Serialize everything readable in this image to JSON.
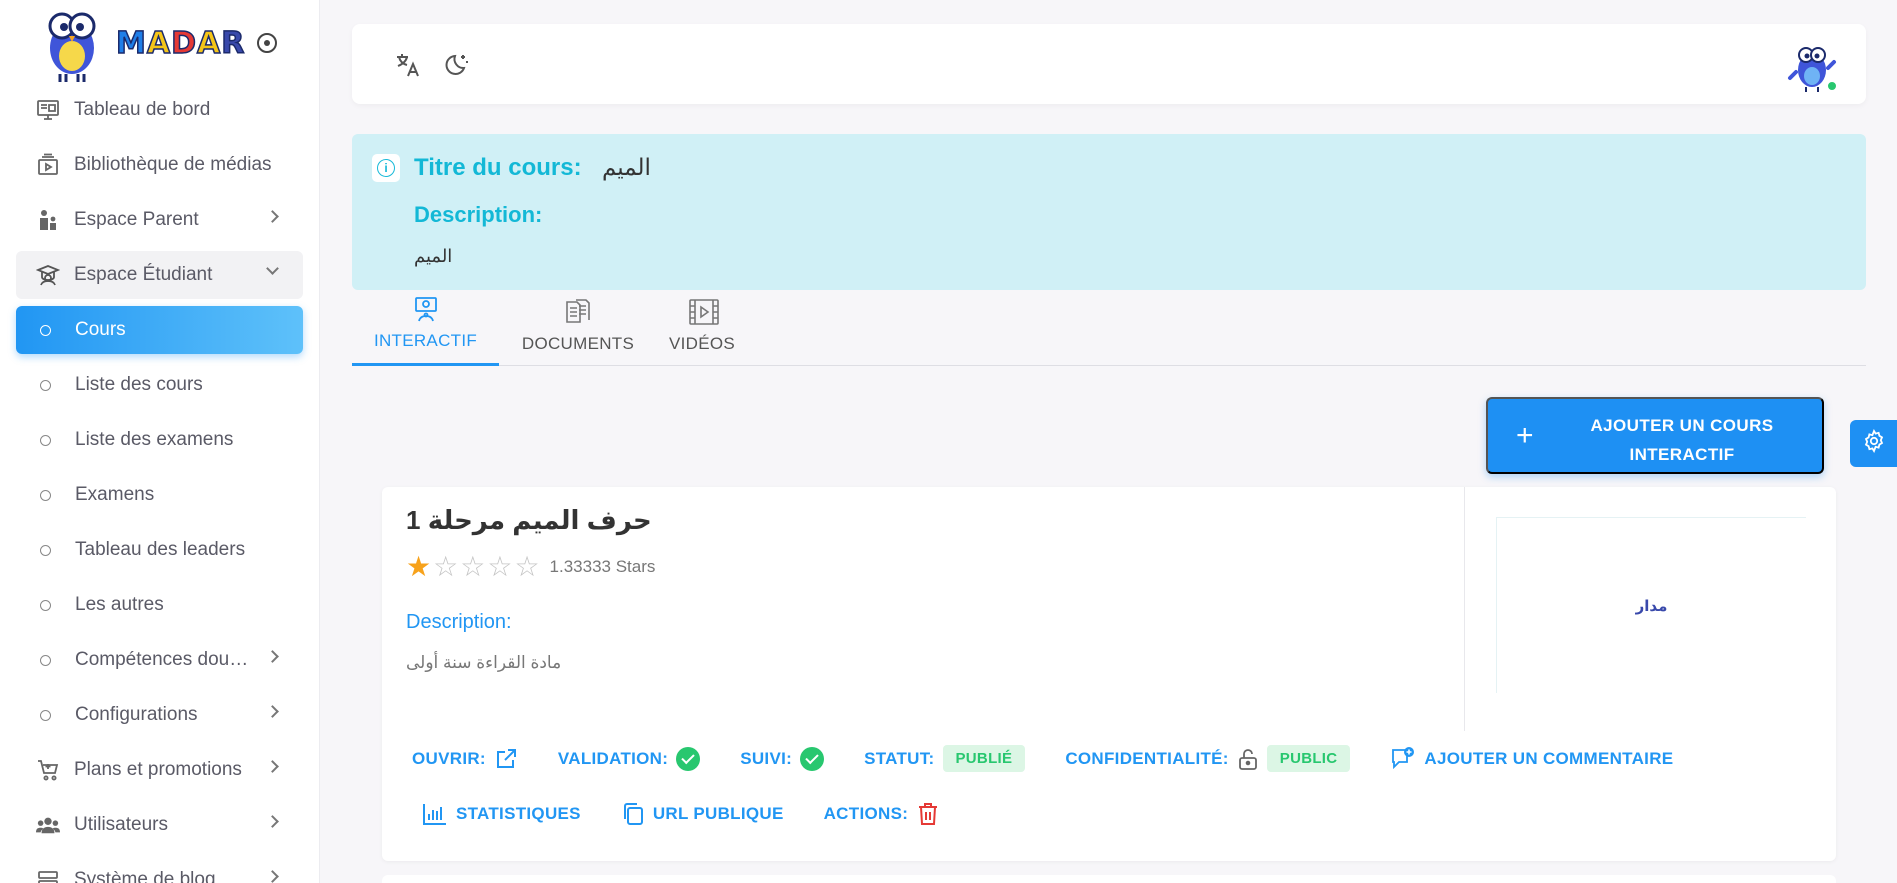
{
  "brand": {
    "name_letters": [
      "M",
      "A",
      "D",
      "A",
      "R"
    ],
    "letter_colors": [
      "#1f7ee8",
      "#f5c518",
      "#e53935",
      "#f5c518",
      "#3949ab"
    ]
  },
  "sidebar": {
    "items": [
      {
        "label": "Tableau de bord",
        "icon": "dashboard-icon"
      },
      {
        "label": "Bibliothèque de médias",
        "icon": "media-library-icon"
      },
      {
        "label": "Espace Parent",
        "icon": "parent-icon"
      },
      {
        "label": "Espace Étudiant",
        "icon": "student-icon"
      }
    ],
    "sub_items": [
      {
        "label": "Cours"
      },
      {
        "label": "Liste des cours"
      },
      {
        "label": "Liste des examens"
      },
      {
        "label": "Examens"
      },
      {
        "label": "Tableau des leaders"
      },
      {
        "label": "Les autres"
      },
      {
        "label": "Compétences dou…"
      },
      {
        "label": "Configurations"
      }
    ],
    "bottom_items": [
      {
        "label": "Plans et promotions",
        "icon": "cart-icon"
      },
      {
        "label": "Utilisateurs",
        "icon": "users-icon"
      },
      {
        "label": "Système de blog",
        "icon": "blog-icon"
      }
    ]
  },
  "course_info": {
    "title_label": "Titre du cours:",
    "title_value": "الميم",
    "description_label": "Description:",
    "description_value": "الميم"
  },
  "tabs": [
    {
      "label": "INTERACTIF",
      "icon": "interactive-icon"
    },
    {
      "label": "DOCUMENTS",
      "icon": "documents-icon"
    },
    {
      "label": "VIDÉOS",
      "icon": "videos-icon"
    }
  ],
  "add_button": {
    "label": "AJOUTER UN COURS INTERACTIF"
  },
  "card": {
    "title": "حرف الميم مرحلة 1",
    "rating": 1.33333,
    "rating_max": 5,
    "rating_text": "1.33333 Stars",
    "description_label": "Description:",
    "description": "مادة القراءة سنة أولى",
    "thumb_logo": "مدار",
    "meta": {
      "open_label": "OUVRIR:",
      "validation_label": "VALIDATION:",
      "tracking_label": "SUIVI:",
      "status_label": "STATUT:",
      "status_value": "PUBLIÉ",
      "privacy_label": "CONFIDENTIALITÉ:",
      "privacy_value": "PUBLIC",
      "comment_label": "AJOUTER UN COMMENTAIRE",
      "stats_label": "STATISTIQUES",
      "public_url_label": "URL PUBLIQUE",
      "actions_label": "ACTIONS:"
    }
  },
  "colors": {
    "accent": "#2196f3",
    "info_bg": "#d0f0f6",
    "info_text": "#13b8d6",
    "success": "#28c76f",
    "danger": "#e53935",
    "star": "#f7a21b"
  }
}
